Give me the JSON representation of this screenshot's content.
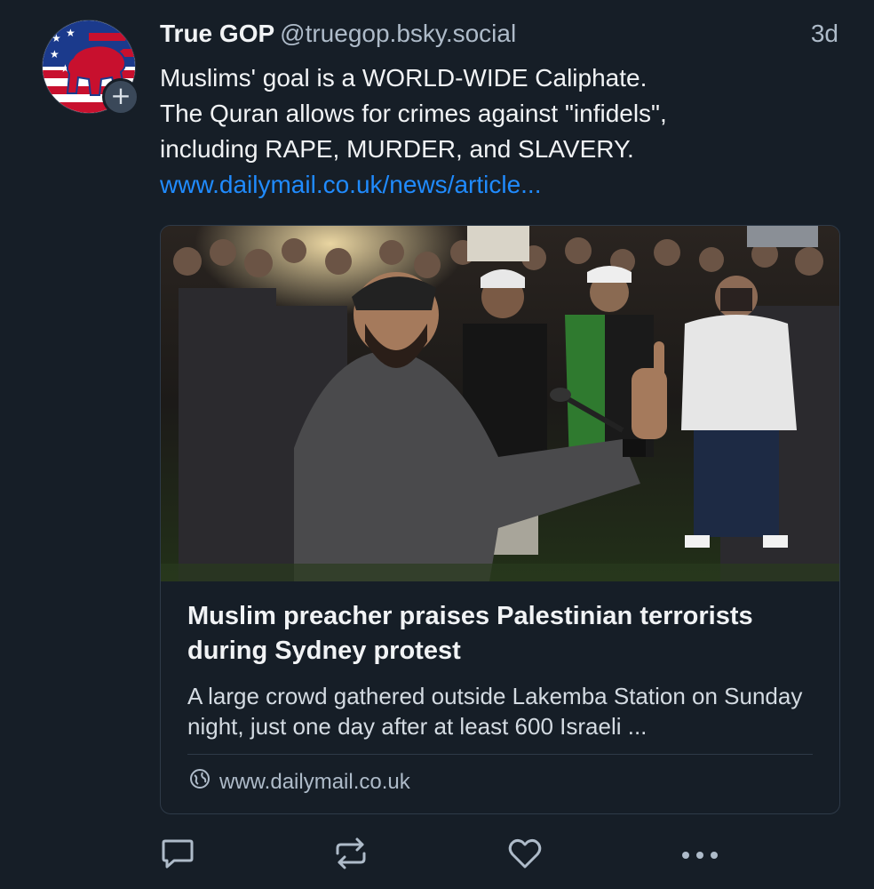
{
  "post": {
    "author": {
      "display_name": "True GOP",
      "handle": "@truegop.bsky.social",
      "avatar_icon": "gop-elephant-avatar-icon",
      "follow_badge": "+"
    },
    "timestamp": "3d",
    "text_lines": [
      "Muslims' goal is a WORLD-WIDE Caliphate.",
      "The Quran allows for crimes against \"infidels\",",
      "including RAPE, MURDER, and SLAVERY."
    ],
    "link_text": "www.dailymail.co.uk/news/article...",
    "embed": {
      "image_icon": "protest-photo",
      "title": "Muslim preacher praises Palestinian terrorists during Sydney protest",
      "description": "A large crowd gathered outside Lakemba Station on Sunday night, just one day after at least 600 Israeli ...",
      "domain": "www.dailymail.co.uk",
      "domain_icon": "globe-icon"
    },
    "actions": [
      {
        "name": "reply-button",
        "icon": "speech-bubble-icon"
      },
      {
        "name": "repost-button",
        "icon": "repost-icon"
      },
      {
        "name": "like-button",
        "icon": "heart-icon"
      },
      {
        "name": "more-button",
        "icon": "ellipsis-icon"
      }
    ]
  },
  "colors": {
    "background": "#161e27",
    "text": "#f1f3f5",
    "muted": "#aebbc9",
    "link": "#208bfe",
    "border": "#2e3a48"
  }
}
